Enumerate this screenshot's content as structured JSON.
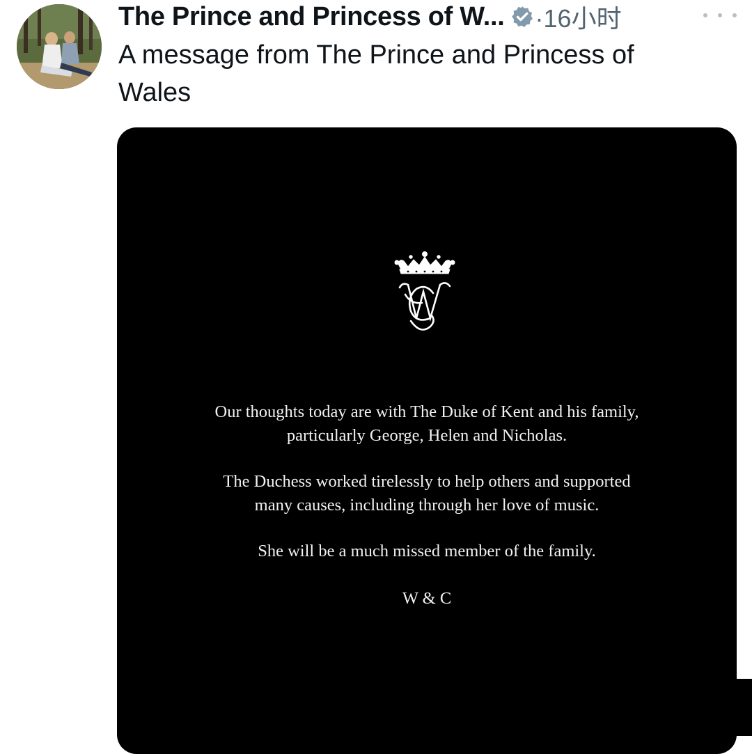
{
  "post": {
    "author_name": "The Prince and Princess of W...",
    "time_ago": "·16小时",
    "text": "A message from The Prince and Princess of Wales",
    "icons": {
      "verified": "verified-badge-icon",
      "more": "more-options-icon",
      "avatar": "profile-avatar"
    }
  },
  "statement": {
    "paragraph1_line1": "Our thoughts today are with The Duke of Kent and his family,",
    "paragraph1_line2": "particularly George, Helen and Nicholas.",
    "paragraph2_line1": "The Duchess worked tirelessly to help others and supported",
    "paragraph2_line2": "many causes, including through her love of music.",
    "paragraph3": "She will be a much missed member of the family.",
    "signature": "W & C",
    "monogram_letters": "WC",
    "emblem": "crown-monogram-icon"
  },
  "colors": {
    "verified_badge": "#829aab",
    "secondary_text": "#536471",
    "card_background": "#000000"
  }
}
